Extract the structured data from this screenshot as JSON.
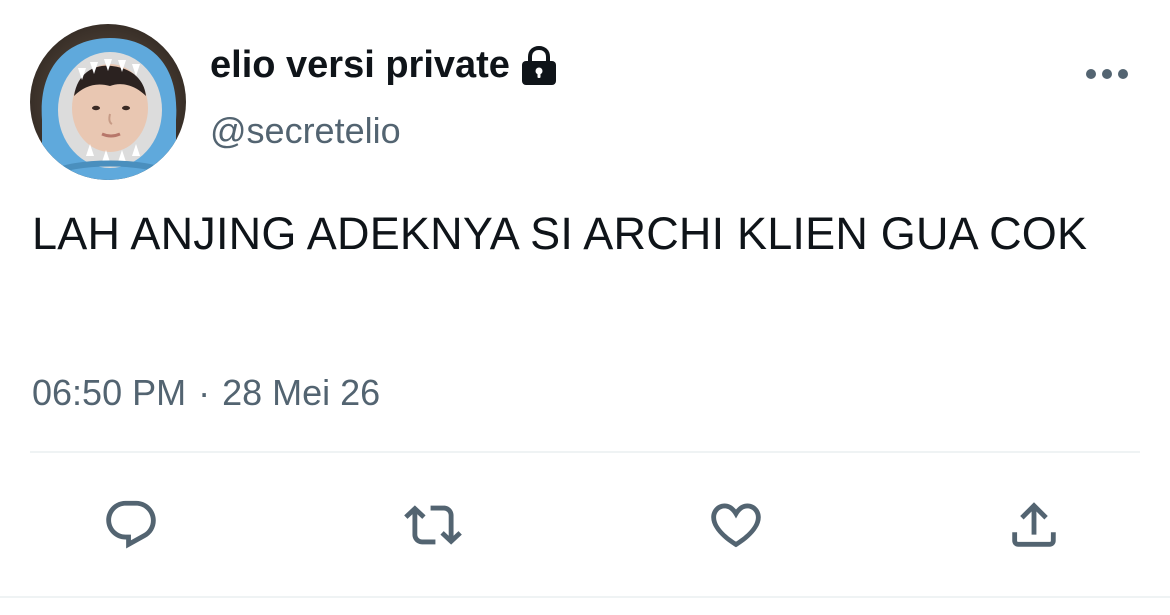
{
  "tweet": {
    "display_name": "elio versi private",
    "handle": "@secretelio",
    "text": "LAH ANJING ADEKNYA SI ARCHI KLIEN GUA COK",
    "time": "06:50 PM",
    "separator": "·",
    "date": "28 Mei 26",
    "protected": true
  },
  "icons": {
    "lock": "lock-icon",
    "more": "more-horizontal-icon",
    "reply": "reply-icon",
    "retweet": "retweet-icon",
    "like": "heart-icon",
    "share": "share-icon"
  },
  "colors": {
    "text_primary": "#0f1419",
    "text_secondary": "#536471",
    "icon": "#536471",
    "divider": "#eff3f4",
    "avatar_hood": "#5fa9dc"
  }
}
